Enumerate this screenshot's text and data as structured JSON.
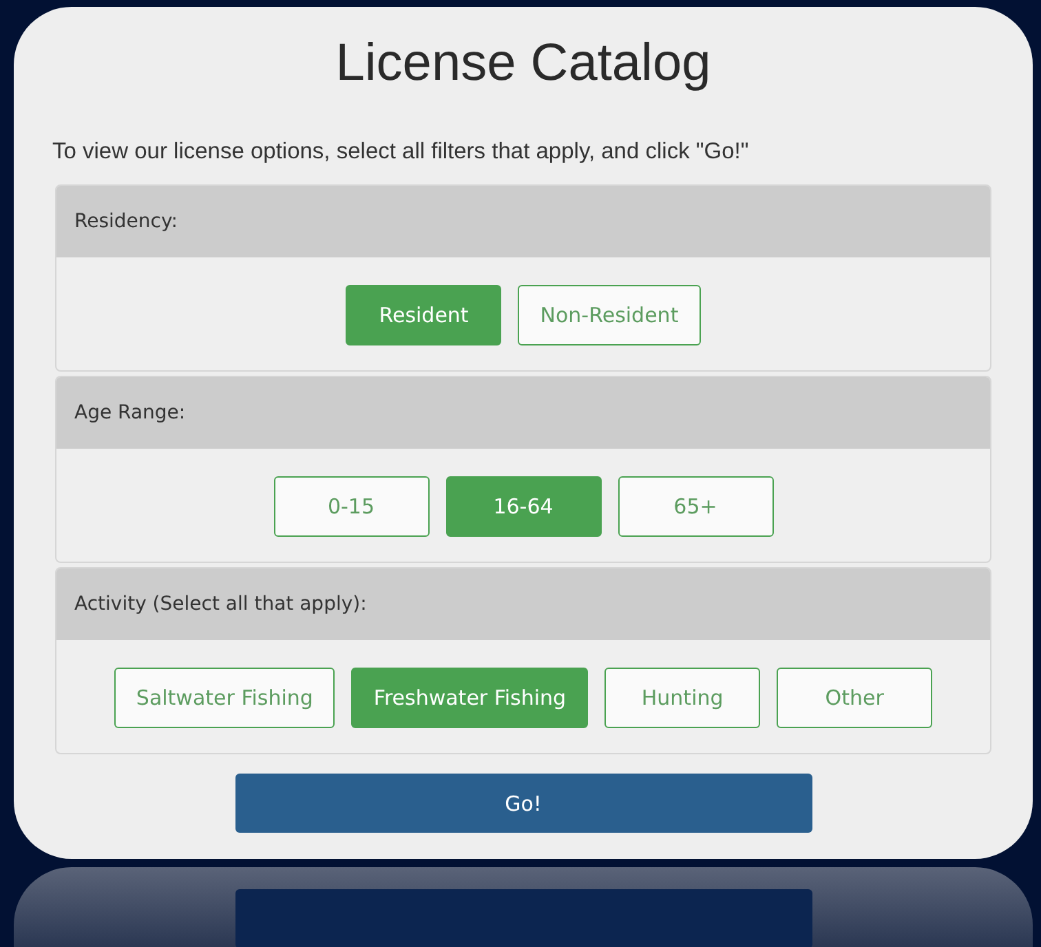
{
  "title": "License Catalog",
  "instructions": "To view our license options, select all filters that apply, and click \"Go!\"",
  "filters": [
    {
      "label": "Residency:",
      "options": [
        {
          "label": "Resident",
          "selected": true
        },
        {
          "label": "Non-Resident",
          "selected": false
        }
      ]
    },
    {
      "label": "Age Range:",
      "options": [
        {
          "label": "0-15",
          "selected": false
        },
        {
          "label": "16-64",
          "selected": true
        },
        {
          "label": "65+",
          "selected": false
        }
      ]
    },
    {
      "label": "Activity (Select all that apply):",
      "options": [
        {
          "label": "Saltwater Fishing",
          "selected": false
        },
        {
          "label": "Freshwater Fishing",
          "selected": true
        },
        {
          "label": "Hunting",
          "selected": false
        },
        {
          "label": "Other",
          "selected": false
        }
      ]
    }
  ],
  "go_button": "Go!"
}
